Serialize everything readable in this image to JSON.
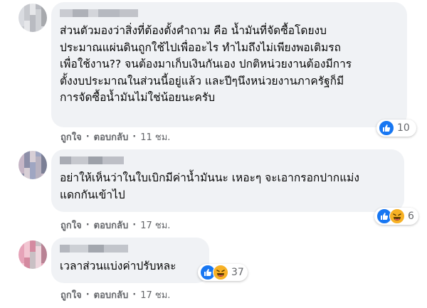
{
  "comments": [
    {
      "text": "ส่วนตัวมองว่าสิ่งที่ต้องตั้งคำถาม คือ น้ำมันที่จัดซื้อโดยงบ\nประมาณแผ่นดินถูกใช้ไปเพื่ออะไร ทำไมถึงไม่เพียงพอเติมรถ\nเพื่อใช้งาน?? จนต้องมาเก็บเงินกันเอง ปกติหน่วยงานต้องมีการ\nตั้งงบประมาณในส่วนนี้อยู่แล้ว และปีๆนึงหน่วยงานภาครัฐก็มี\nการจัดซื้อน้ำมันไม่ใช่น้อยนะครับ",
      "like_label": "ถูกใจ",
      "reply_label": "ตอบกลับ",
      "time": "11 ชม.",
      "reactions": [
        "like-icon"
      ],
      "reaction_count": "10"
    },
    {
      "text": "อย่าให้เห็นว่าในใบเบิกมีค่าน้ำมันนะ เหอะๆ จะเอากรอกปากแม่ง\nแดกกันเข้าไป",
      "like_label": "ถูกใจ",
      "reply_label": "ตอบกลับ",
      "time": "17 ชม.",
      "reactions": [
        "like-icon",
        "haha-icon"
      ],
      "reaction_count": "6"
    },
    {
      "text": "เวลาส่วนแบ่งค่าปรับหละ",
      "like_label": "ถูกใจ",
      "reply_label": "ตอบกลับ",
      "time": "17 ชม.",
      "reactions": [
        "like-icon",
        "haha-icon"
      ],
      "reaction_count": "37"
    }
  ],
  "colors": {
    "bubble": "#f0f2f5",
    "secondary_text": "#65676b",
    "like_blue": "#1877f2",
    "haha_yellow": "#f7b125"
  }
}
